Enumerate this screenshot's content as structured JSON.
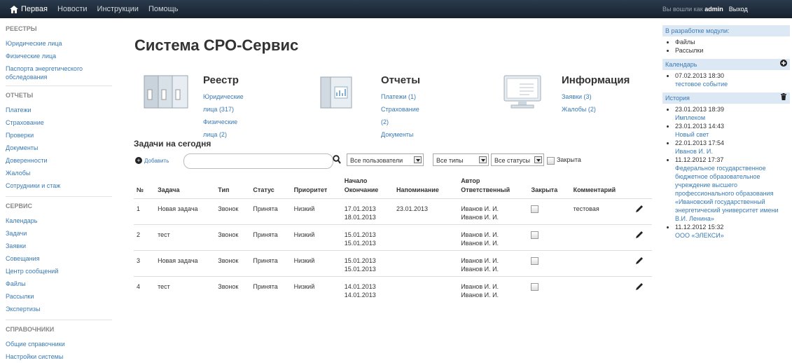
{
  "topbar": {
    "items": [
      "Первая",
      "Новости",
      "Инструкции",
      "Помощь"
    ],
    "who_prefix": "Вы вошли как",
    "user": "admin",
    "logout": "Выход"
  },
  "sidebar": {
    "registry_title": "РЕЕСТРЫ",
    "registry": [
      "Юридические лица",
      "Физические лица",
      "Паспорта энергетического обследования"
    ],
    "reports_title": "ОТЧЕТЫ",
    "reports": [
      "Платежи",
      "Страхование",
      "Проверки",
      "Документы",
      "Доверенности",
      "Жалобы",
      "Сотрудники и стаж"
    ],
    "service_title": "СЕРВИС",
    "service": [
      "Календарь",
      "Задачи",
      "Заявки",
      "Совещания",
      "Центр сообщений",
      "Файлы",
      "Рассылки",
      "Экспертизы"
    ],
    "ref_title": "СПРАВОЧНИКИ",
    "ref": [
      "Общие справочники",
      "Настройки системы"
    ]
  },
  "main": {
    "title": "Система СРО-Сервис",
    "blocks": [
      {
        "heading": "Реестр",
        "links": [
          "Юридические лица (317)",
          "Физические лица (2)"
        ]
      },
      {
        "heading": "Отчеты",
        "links": [
          "Платежи (1)",
          "Страхование (2)",
          "Документы"
        ]
      },
      {
        "heading": "Информация",
        "links": [
          "Заявки (3)",
          "Жалобы (2)"
        ]
      }
    ]
  },
  "tasks": {
    "heading": "Задачи на сегодня",
    "add_label": "Добавить",
    "search_placeholder": "",
    "users_filter": "Все пользователи",
    "types_filter": "Все типы",
    "status_filter": "Все статусы",
    "closed_label": "Закрыта",
    "columns": {
      "num": "№",
      "task": "Задача",
      "type": "Тип",
      "status": "Статус",
      "priority": "Приоритет",
      "start": "Начало",
      "end": "Окончание",
      "reminder": "Напоминание",
      "author": "Автор",
      "responsible": "Ответственный",
      "closed": "Закрыта",
      "comment": "Комментарий"
    },
    "rows": [
      {
        "num": "1",
        "task": "Новая задача",
        "type": "Звонок",
        "status": "Принята",
        "priority": "Низкий",
        "start": "17.01.2013",
        "end": "18.01.2013",
        "reminder": "23.01.2013",
        "author": "Иванов И. И.",
        "responsible": "Иванов И. И.",
        "comment": "тестовая"
      },
      {
        "num": "2",
        "task": "тест",
        "type": "Звонок",
        "status": "Принята",
        "priority": "Низкий",
        "start": "15.01.2013",
        "end": "15.01.2013",
        "reminder": "",
        "author": "Иванов И. И.",
        "responsible": "Иванов И. И.",
        "comment": ""
      },
      {
        "num": "3",
        "task": "Новая задача",
        "type": "Звонок",
        "status": "Принята",
        "priority": "Низкий",
        "start": "15.01.2013",
        "end": "15.01.2013",
        "reminder": "",
        "author": "Иванов И. И.",
        "responsible": "Иванов И. И.",
        "comment": ""
      },
      {
        "num": "4",
        "task": "тест",
        "type": "Звонок",
        "status": "Принята",
        "priority": "Низкий",
        "start": "14.01.2013",
        "end": "14.01.2013",
        "reminder": "",
        "author": "Иванов И. И.",
        "responsible": "Иванов И. И.",
        "comment": ""
      }
    ]
  },
  "right": {
    "dev_title": "В разработке модули:",
    "dev_items": [
      "Файлы",
      "Рассылки"
    ],
    "calendar_title": "Календарь",
    "calendar_items": [
      {
        "date": "07.02.2013 18:30",
        "text": "тестовое событие"
      }
    ],
    "history_title": "История",
    "history_items": [
      {
        "date": "23.01.2013 18:39",
        "text": "Имплеком"
      },
      {
        "date": "23.01.2013 14:43",
        "text": "Новый свет"
      },
      {
        "date": "22.01.2013 17:54",
        "text": "Иванов И. И."
      },
      {
        "date": "11.12.2012 17:37",
        "text": "Федеральное государственное бюджетное образовательное учреждение высшего профессионального образования «Ивановский государственный энергетический университет имени В.И. Ленина»"
      },
      {
        "date": "11.12.2012 15:32",
        "text": "ООО «ЭЛЕКСИ»"
      }
    ]
  },
  "icons": {
    "home": "home-icon",
    "search": "search-icon",
    "add": "plus-circle-icon",
    "edit": "pencil-icon",
    "trash": "trash-icon"
  }
}
